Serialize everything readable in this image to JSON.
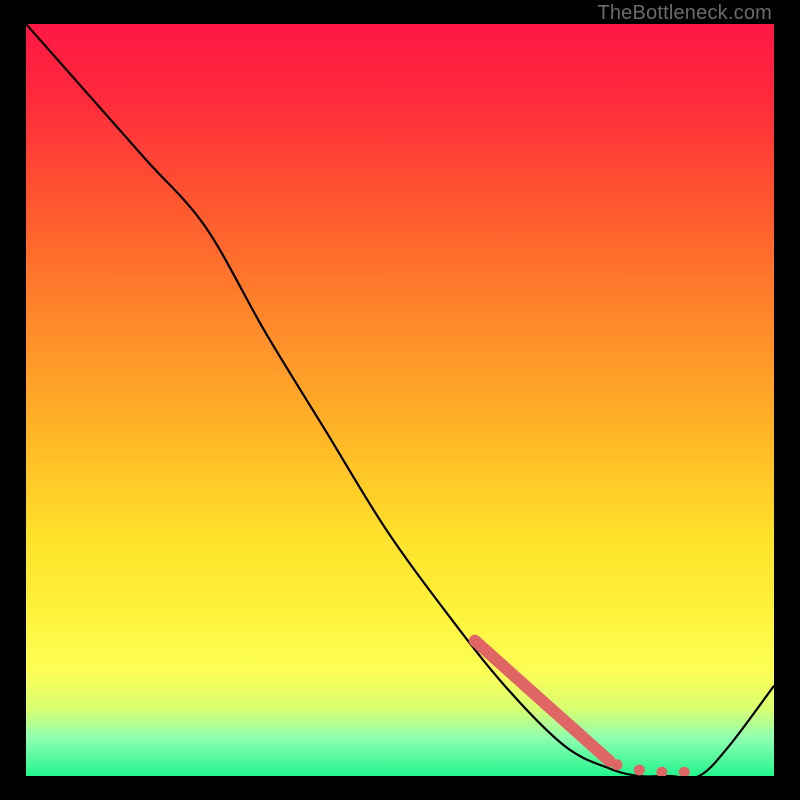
{
  "watermark": "TheBottleneck.com",
  "chart_data": {
    "type": "line",
    "title": "",
    "xlabel": "",
    "ylabel": "",
    "xlim": [
      0,
      100
    ],
    "ylim": [
      0,
      100
    ],
    "series": [
      {
        "name": "curve",
        "x": [
          0,
          8,
          16,
          24,
          32,
          40,
          48,
          56,
          64,
          72,
          78,
          82,
          86,
          90,
          94,
          100
        ],
        "y": [
          100,
          91,
          82,
          73,
          59,
          46,
          33,
          22,
          12,
          4,
          1,
          0,
          0,
          0,
          4,
          12
        ]
      }
    ],
    "highlight_segment": {
      "x": [
        60,
        78
      ],
      "y": [
        18,
        2
      ],
      "dots": [
        {
          "x": 79,
          "y": 1.5
        },
        {
          "x": 82,
          "y": 0.8
        },
        {
          "x": 85,
          "y": 0.5
        },
        {
          "x": 88,
          "y": 0.5
        }
      ]
    },
    "gradient_stops": [
      {
        "offset": 0.0,
        "color": "#ff1744"
      },
      {
        "offset": 0.1,
        "color": "#ff2a3c"
      },
      {
        "offset": 0.25,
        "color": "#ff5a2e"
      },
      {
        "offset": 0.4,
        "color": "#ff8a2a"
      },
      {
        "offset": 0.55,
        "color": "#ffb726"
      },
      {
        "offset": 0.68,
        "color": "#ffe12a"
      },
      {
        "offset": 0.78,
        "color": "#fff23a"
      },
      {
        "offset": 0.86,
        "color": "#fdff55"
      },
      {
        "offset": 0.91,
        "color": "#d9ff70"
      },
      {
        "offset": 0.95,
        "color": "#8dffb0"
      },
      {
        "offset": 1.0,
        "color": "#23f58e"
      }
    ]
  }
}
